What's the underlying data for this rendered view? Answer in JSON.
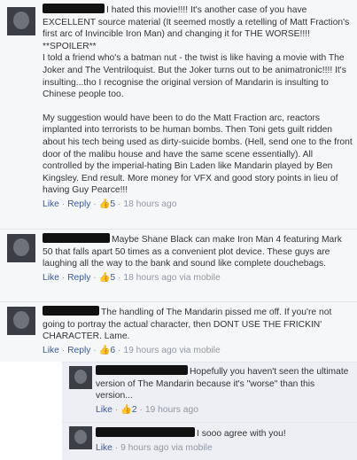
{
  "ui": {
    "like": "Like",
    "reply": "Reply",
    "dot": "·",
    "link_color": "#3b5998",
    "meta_color": "#9197a3"
  },
  "comments": [
    {
      "paragraphs": [
        "I hated this movie!!!! It's another case of you have EXCELLENT source material (It seemed mostly a retelling of Matt Fraction's first arc of Invincible Iron Man) and changing it for THE WORSE!!!!",
        "**SPOILER**",
        "I told a friend who's a batman nut - the twist is like having a movie with The Joker and The Ventriloquist. But the Joker turns out to be animatronic!!!! It's insulting...tho I recognise the original version of Mandarin is insulting to Chinese people too.",
        "My suggestion would have been to do the Matt Fraction arc, reactors implanted into terrorists to be human bombs. Then Toni gets guilt ridden about his tech being used as dirty-suicide bombs. (Hell, send one to the front door of the malibu house and have the same scene essentially). All controlled by the imperial-hating Bin Laden like Mandarin played by Ben Kingsley. End result. More money for VFX and good story points in lieu of having Guy Pearce!!!"
      ],
      "likes": "5",
      "time": "18 hours ago"
    },
    {
      "text": "Maybe Shane Black can make Iron Man 4 featuring Mark 50 that falls apart 50 times as a convenient plot device. These guys are laughing all the way to the bank and sound like complete douchebags.",
      "likes": "5",
      "time": "18 hours ago",
      "via": "via mobile"
    },
    {
      "text": "The handling of The Mandarin pissed me off. If you're not going to portray the actual character, then DONT USE THE FRICKIN' CHARACTER. Lame.",
      "likes": "6",
      "time": "19 hours ago",
      "via": "via mobile"
    }
  ],
  "replies": [
    {
      "text": "Hopefully you haven't seen the ultimate version of The Mandarin because it's \"worse\" than this version...",
      "likes": "2",
      "time": "19 hours ago"
    },
    {
      "text": "I sooo agree with you!",
      "time": "9 hours ago",
      "via": "via mobile"
    }
  ]
}
